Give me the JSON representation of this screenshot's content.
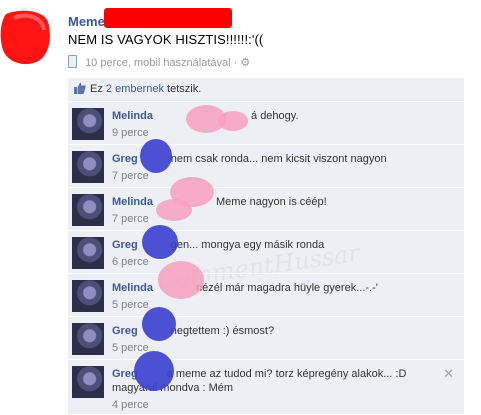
{
  "post": {
    "author": "Meme",
    "text": "NEM IS VAGYOK HISZTIS!!!!!!:'((",
    "meta": "10 perce, mobil használatával ·",
    "colors": {
      "link": "#3b5998",
      "redaction": "#ff0000",
      "pink_blur": "#f7a0bd",
      "blue_blur": "#3a3fd0"
    }
  },
  "likes": {
    "prefix": "Ez ",
    "link": "2 embernek",
    "suffix": " tetszik."
  },
  "comments": [
    {
      "author": "Melinda",
      "text": "á dehogy.",
      "time": "9 perce"
    },
    {
      "author": "Greg",
      "text": "nem csak ronda... nem kicsit viszont nagyon",
      "time": "7 perce"
    },
    {
      "author": "Melinda",
      "text": "Meme nagyon is céép!",
      "time": "7 perce"
    },
    {
      "author": "Greg",
      "text": "gen... mongya egy másik ronda",
      "time": "6 perce"
    },
    {
      "author": "Melinda",
      "text": "nézél már magadra hüyle gyerek...-.-'",
      "time": "5 perce"
    },
    {
      "author": "Greg",
      "text": "negtettem :) ésmost?",
      "time": "5 perce"
    },
    {
      "author": "Greg",
      "text": "a meme az tudod mi? torz képregény alakok... :D magyarul mondva : Mém",
      "time": "4 perce"
    }
  ],
  "watermark": "CommentHussar"
}
